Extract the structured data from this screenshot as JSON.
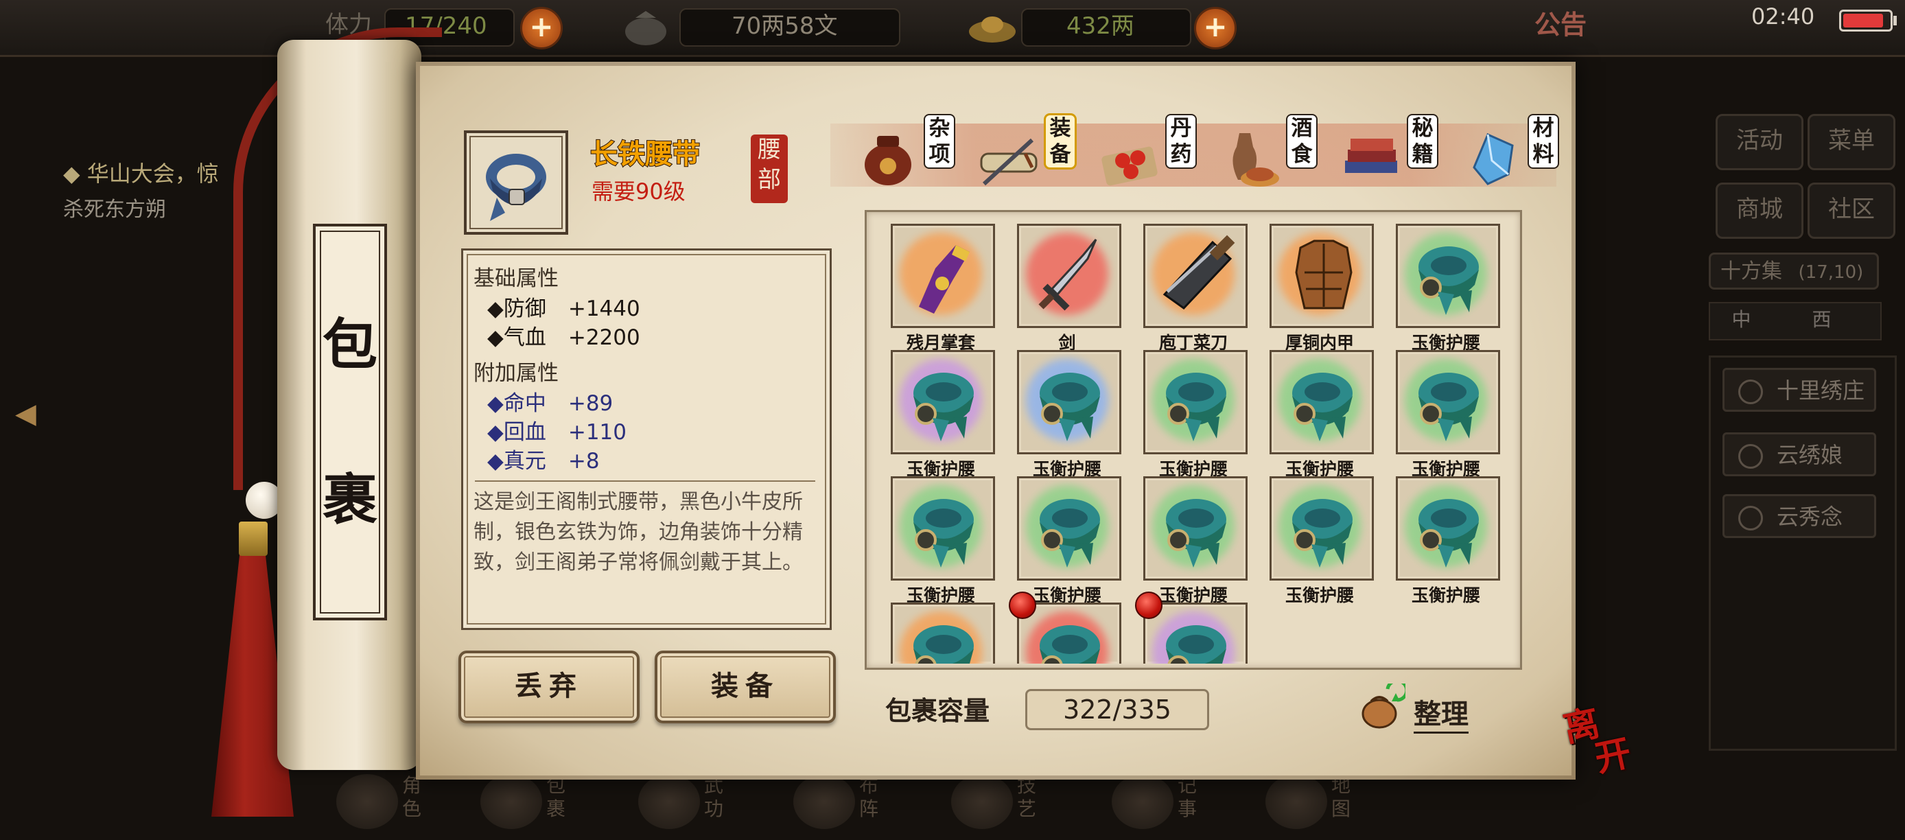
{
  "status_bar": {
    "weight_label": "体力",
    "weight_value": "17/240",
    "money_value": "70两58文",
    "gold_value": "432两",
    "notice_label": "公告",
    "clock": "02:40"
  },
  "quest": {
    "title": "◆ 华山大会，惊",
    "subtitle": "杀死东方朔"
  },
  "scroll_title": [
    "包",
    "裹"
  ],
  "item": {
    "name": "长铁腰带",
    "requirement": "需要90级",
    "slot": [
      "腰",
      "部"
    ],
    "base_header": "基础属性",
    "base_attrs": [
      {
        "name": "防御",
        "value": "+1440"
      },
      {
        "name": "气血",
        "value": "+2200"
      }
    ],
    "extra_header": "附加属性",
    "extra_attrs": [
      {
        "name": "命中",
        "value": "+89"
      },
      {
        "name": "回血",
        "value": "+110"
      },
      {
        "name": "真元",
        "value": "+8"
      }
    ],
    "description": "这是剑王阁制式腰带，黑色小牛皮所制，银色玄铁为饰，边角装饰十分精致，剑王阁弟子常将佩剑戴于其上。"
  },
  "buttons": {
    "discard": "丢弃",
    "equip": "装备"
  },
  "tabs": [
    {
      "label": [
        "杂",
        "项"
      ],
      "icon": "jar-icon"
    },
    {
      "label": [
        "装",
        "备"
      ],
      "icon": "scroll-sword-icon",
      "active": true
    },
    {
      "label": [
        "丹",
        "药"
      ],
      "icon": "pills-icon"
    },
    {
      "label": [
        "酒",
        "食"
      ],
      "icon": "wine-food-icon"
    },
    {
      "label": [
        "秘",
        "籍"
      ],
      "icon": "books-icon"
    },
    {
      "label": [
        "材",
        "料"
      ],
      "icon": "crystal-icon"
    }
  ],
  "inventory": [
    {
      "name": "残月掌套",
      "icon": "gauntlet-icon",
      "quality": "orange"
    },
    {
      "name": "剑",
      "icon": "sword-icon",
      "quality": "red"
    },
    {
      "name": "庖丁菜刀",
      "icon": "cleaver-icon",
      "quality": "orange"
    },
    {
      "name": "厚铜内甲",
      "icon": "armor-icon",
      "quality": "orange"
    },
    {
      "name": "玉衡护腰",
      "icon": "belt-icon",
      "quality": "green"
    },
    {
      "name": "玉衡护腰",
      "icon": "belt-icon",
      "quality": "purple"
    },
    {
      "name": "玉衡护腰",
      "icon": "belt-icon",
      "quality": "blue"
    },
    {
      "name": "玉衡护腰",
      "icon": "belt-icon",
      "quality": "green"
    },
    {
      "name": "玉衡护腰",
      "icon": "belt-icon",
      "quality": "green"
    },
    {
      "name": "玉衡护腰",
      "icon": "belt-icon",
      "quality": "green"
    },
    {
      "name": "玉衡护腰",
      "icon": "belt-icon",
      "quality": "green"
    },
    {
      "name": "玉衡护腰",
      "icon": "belt-icon",
      "quality": "green"
    },
    {
      "name": "玉衡护腰",
      "icon": "belt-icon",
      "quality": "green"
    },
    {
      "name": "玉衡护腰",
      "icon": "belt-icon",
      "quality": "green"
    },
    {
      "name": "玉衡护腰",
      "icon": "belt-icon",
      "quality": "green"
    },
    {
      "name": "",
      "icon": "belt-icon",
      "quality": "orange"
    },
    {
      "name": "",
      "icon": "belt-icon",
      "quality": "red",
      "new": true
    },
    {
      "name": "",
      "icon": "belt-icon",
      "quality": "purple",
      "new": true
    }
  ],
  "capacity": {
    "label": "包裹容量",
    "value": "322/335"
  },
  "sort_label": "整理",
  "leave_label": [
    "离",
    "开"
  ],
  "right_menu": {
    "buttons": [
      "活动",
      "菜单",
      "商城",
      "社区"
    ],
    "location": "十方集",
    "location_coords": "(17,10)",
    "compass": "中 西",
    "npcs": [
      "十里绣庄",
      "云绣娘",
      "云秀念"
    ]
  },
  "bottom_nav": [
    "角色",
    "包裹",
    "武功",
    "布阵",
    "技艺",
    "记事",
    "地图"
  ],
  "colors": {
    "quality_orange": "#f4a25a",
    "quality_red": "#ef6a60",
    "quality_green": "#8fd28a",
    "quality_purple": "#c99ae0",
    "quality_blue": "#8fb3ee",
    "item_name": "#f3a000",
    "requirement_red": "#c41e12",
    "extra_attr_blue": "#2b2f7c"
  }
}
